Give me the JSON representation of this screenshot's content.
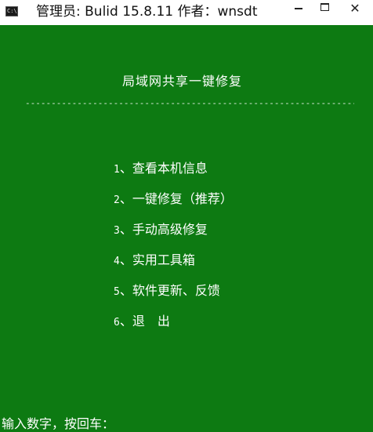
{
  "window": {
    "title": "管理员: Bulid 15.8.11  作者：wnsdt",
    "icon": "console-icon",
    "icon_glyph": "C:\\",
    "controls": {
      "minimize_icon": "minimize-icon",
      "maximize_icon": "maximize-icon",
      "close_glyph": "✕"
    }
  },
  "console": {
    "title": "局域网共享一键修复",
    "separator": "-----------------------------------------------------------------------------------------",
    "menu": [
      {
        "num": "1",
        "label": "、查看本机信息"
      },
      {
        "num": "2",
        "label": "、一键修复（推荐）"
      },
      {
        "num": "3",
        "label": "、手动高级修复"
      },
      {
        "num": "4",
        "label": "、实用工具箱"
      },
      {
        "num": "5",
        "label": "、软件更新、反馈"
      },
      {
        "num": "6",
        "label": "、退　出"
      }
    ],
    "prompt": "输入数字，按回车："
  },
  "colors": {
    "console_bg": "#0d7a12",
    "console_fg": "#ffffff",
    "titlebar_bg": "#ffffff"
  }
}
